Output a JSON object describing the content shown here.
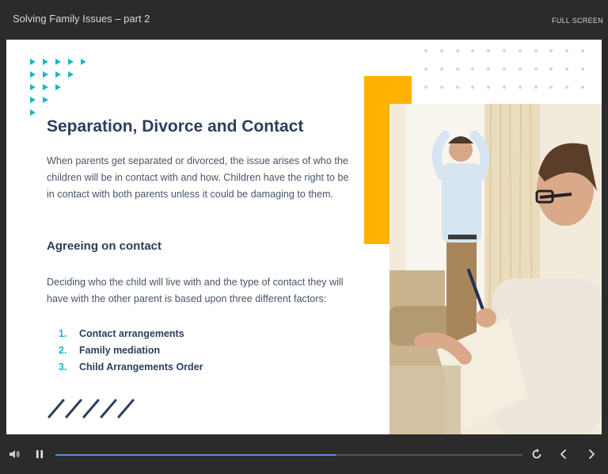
{
  "header": {
    "title": "Solving Family Issues – part 2",
    "fullscreen_label": "FULL SCREEN"
  },
  "slide": {
    "heading": "Separation, Divorce and Contact",
    "paragraph1": "When parents get separated or divorced, the issue arises of who the children will be in contact with and how. Children have the right to be in contact with both parents unless it could be damaging to them.",
    "subheading": "Agreeing on contact",
    "paragraph2": "Deciding who the child will live with and the type of contact they will have with the other parent is based upon three different factors:",
    "factors": [
      {
        "num": "1.",
        "label": "Contact arrangements"
      },
      {
        "num": "2.",
        "label": "Family mediation"
      },
      {
        "num": "3.",
        "label": "Child Arrangements Order"
      }
    ],
    "accent_color": "#1ab6c5",
    "highlight_color": "#ffb300",
    "heading_color": "#2c3e5c"
  },
  "controls": {
    "progress": 0.6,
    "icons": [
      "volume-icon",
      "pause-icon",
      "replay-icon",
      "prev-icon",
      "next-icon"
    ]
  }
}
